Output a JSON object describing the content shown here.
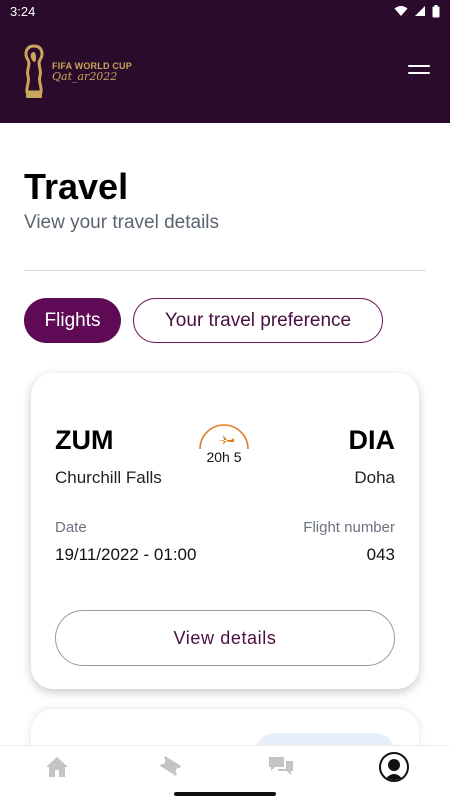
{
  "status_bar": {
    "time": "3:24"
  },
  "header": {
    "logo_line1": "FIFA WORLD CUP",
    "logo_line2": "Qat_ar2022",
    "menu_icon": "hamburger-menu-icon",
    "background": "#2a0b2c",
    "accent_gold": "#c9a55a"
  },
  "page": {
    "title": "Travel",
    "subtitle": "View your travel details"
  },
  "tabs": [
    {
      "label": "Flights",
      "active": true
    },
    {
      "label": "Your travel preference",
      "active": false
    }
  ],
  "flight": {
    "from_code": "ZUM",
    "from_city": "Churchill Falls",
    "to_code": "DIA",
    "to_city": "Doha",
    "duration": "20h 5",
    "date_label": "Date",
    "date_value": "19/11/2022 - 01:00",
    "flight_number_label": "Flight number",
    "flight_number_value": "043",
    "button_label": "View details",
    "plane_icon": "plane-icon",
    "accent_orange": "#e07a1f"
  },
  "bottom_nav": [
    {
      "icon": "home-icon"
    },
    {
      "icon": "ticket-icon"
    },
    {
      "icon": "chat-icon"
    },
    {
      "icon": "profile-icon",
      "active": true
    }
  ],
  "colors": {
    "primary_maroon": "#5f0a54",
    "subtitle_gray": "#5a6470"
  }
}
